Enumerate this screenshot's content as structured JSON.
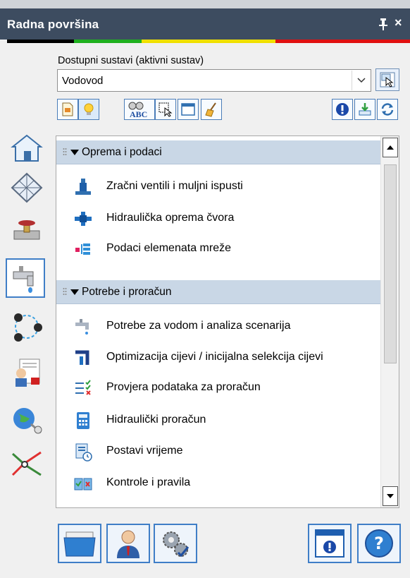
{
  "window": {
    "title": "Radna površina",
    "pin_icon": "pin-icon",
    "close_label": "×"
  },
  "status_colors": [
    "#000000",
    "#1fb01f",
    "#f0e000",
    "#f0e000",
    "#e01010",
    "#e01010"
  ],
  "system": {
    "label": "Dostupni sustavi (aktivni sustav)",
    "value": "Vodovod"
  },
  "toolbar": {
    "left": [
      "new-document-icon",
      "lightbulb-icon",
      "spell-check-icon",
      "select-cursor-icon",
      "window-icon",
      "broom-icon"
    ],
    "right": [
      "info-icon",
      "import-icon",
      "refresh-icon"
    ]
  },
  "sidebar": [
    "house-icon",
    "grid-icon",
    "valve-pipe-icon",
    "faucet-icon",
    "network-nodes-icon",
    "report-user-icon",
    "globe-satellite-icon",
    "metro-lines-icon"
  ],
  "groups": [
    {
      "title": "Oprema i podaci",
      "items": [
        {
          "label": "Zračni ventili i muljni ispusti",
          "icon": "air-valve-icon"
        },
        {
          "label": "Hidraulička oprema čvora",
          "icon": "node-equipment-icon"
        },
        {
          "label": "Podaci elemenata mreže",
          "icon": "network-data-icon"
        }
      ]
    },
    {
      "title": "Potrebe i proračun",
      "items": [
        {
          "label": "Potrebe za vodom i analiza scenarija",
          "icon": "water-demand-icon"
        },
        {
          "label": "Optimizacija cijevi / inicijalna selekcija cijevi",
          "icon": "pipe-optimize-icon"
        },
        {
          "label": "Provjera podataka za proračun",
          "icon": "checklist-icon"
        },
        {
          "label": "Hidraulički proračun",
          "icon": "calculator-icon"
        },
        {
          "label": "Postavi vrijeme",
          "icon": "clock-document-icon"
        },
        {
          "label": "Kontrole i pravila",
          "icon": "rules-book-icon"
        }
      ]
    }
  ],
  "bottom": [
    "folder-icon",
    "user-icon",
    "settings-gears-icon",
    "info-window-icon",
    "help-icon"
  ]
}
